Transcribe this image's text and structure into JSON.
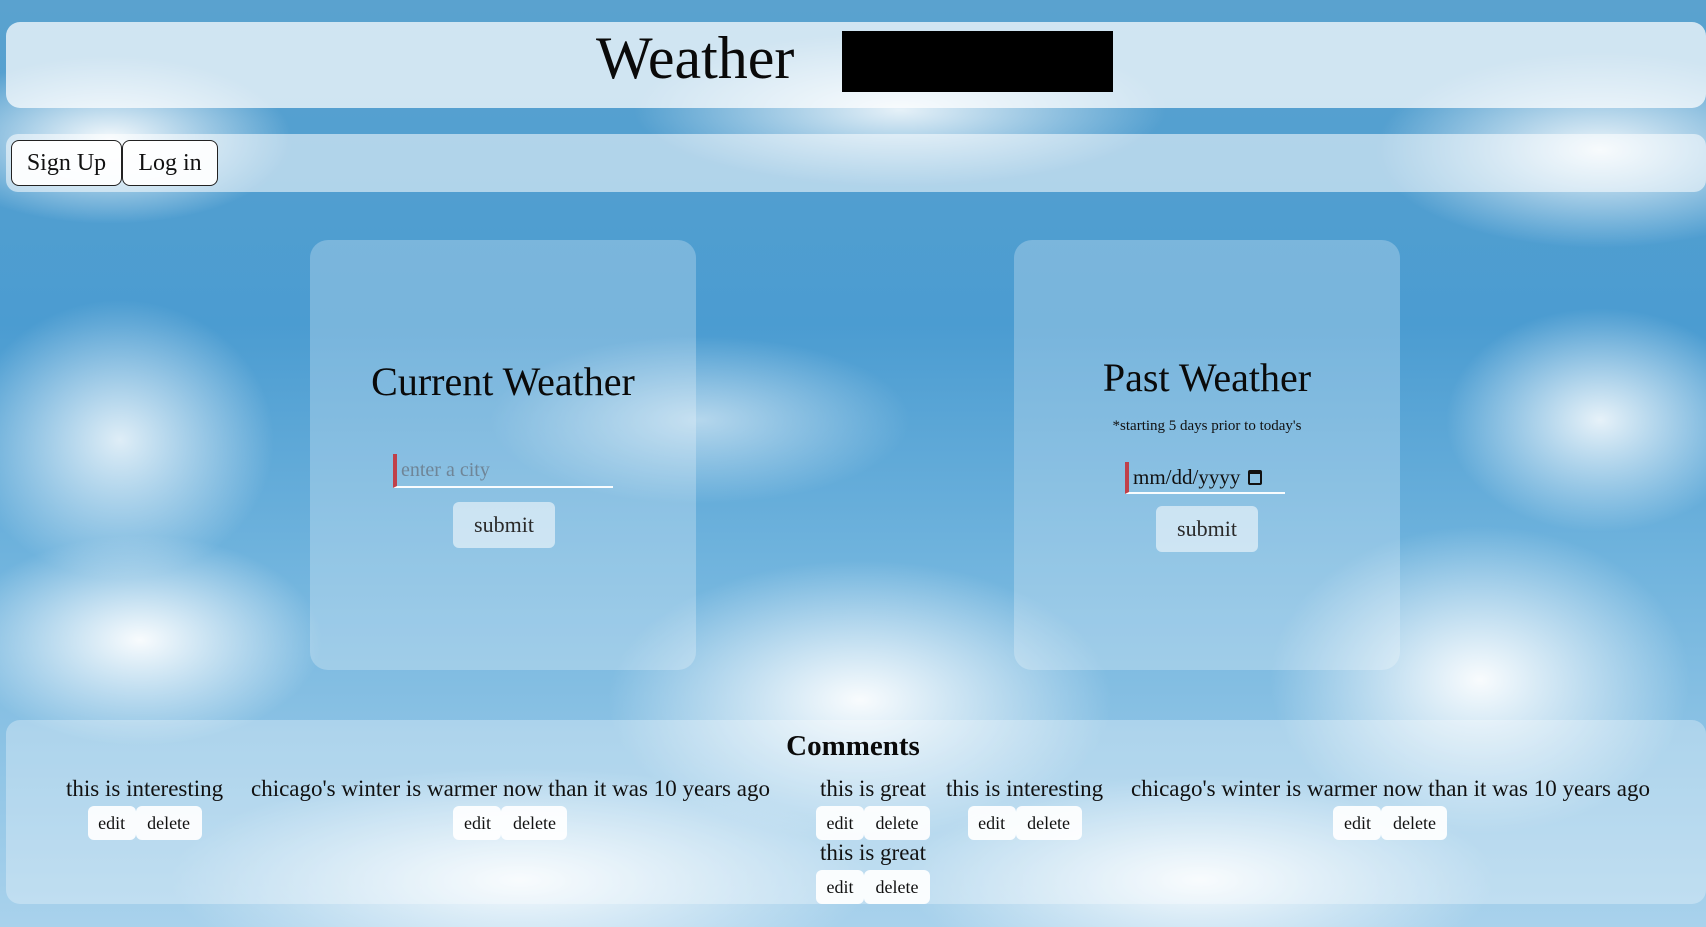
{
  "header": {
    "title": "Weather"
  },
  "nav": {
    "signup_label": "Sign Up",
    "login_label": "Log in"
  },
  "current_weather": {
    "title": "Current Weather",
    "city_placeholder": "enter a city",
    "submit_label": "submit"
  },
  "past_weather": {
    "title": "Past Weather",
    "note": "*starting 5 days prior to today's",
    "date_placeholder": "mm/dd/yyyy",
    "submit_label": "submit"
  },
  "comments": {
    "title": "Comments",
    "edit_label": "edit",
    "delete_label": "delete",
    "items": [
      {
        "text": "this is interesting"
      },
      {
        "text": "chicago's winter is warmer now than it was 10 years ago"
      },
      {
        "text": "this is great"
      },
      {
        "text": "this is interesting"
      },
      {
        "text": "chicago's winter is warmer now than it was 10 years ago"
      },
      {
        "text": "this is great"
      }
    ]
  },
  "colors": {
    "sky": "#4b9cd1",
    "input_accent": "#c0404a",
    "redaction": "#000000"
  },
  "icons": {
    "date": "calendar-icon"
  }
}
